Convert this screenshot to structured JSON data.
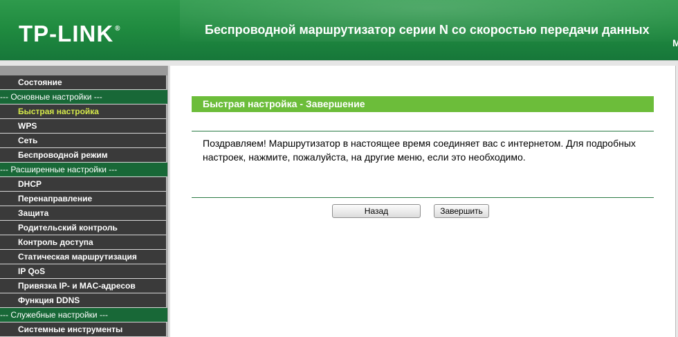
{
  "header": {
    "logo": "TP-LINK",
    "logo_mark": "®",
    "title": "Беспроводной маршрутизатор серии N со скоростью передачи данных",
    "subtitle": "М"
  },
  "sidebar": {
    "items": [
      {
        "label": "Состояние",
        "type": "item"
      },
      {
        "label": "--- Основные настройки ---",
        "type": "group"
      },
      {
        "label": "Быстрая настройка",
        "type": "item",
        "active": true
      },
      {
        "label": "WPS",
        "type": "item"
      },
      {
        "label": "Сеть",
        "type": "item"
      },
      {
        "label": "Беспроводной режим",
        "type": "item"
      },
      {
        "label": "--- Расширенные настройки ---",
        "type": "group"
      },
      {
        "label": "DHCP",
        "type": "item"
      },
      {
        "label": "Перенаправление",
        "type": "item"
      },
      {
        "label": "Защита",
        "type": "item"
      },
      {
        "label": "Родительский контроль",
        "type": "item"
      },
      {
        "label": "Контроль доступа",
        "type": "item"
      },
      {
        "label": "Статическая маршрутизация",
        "type": "item"
      },
      {
        "label": "IP QoS",
        "type": "item"
      },
      {
        "label": "Привязка IP- и MAC-адресов",
        "type": "item"
      },
      {
        "label": "Функция DDNS",
        "type": "item"
      },
      {
        "label": "--- Служебные настройки ---",
        "type": "group"
      },
      {
        "label": "Системные инструменты",
        "type": "item"
      }
    ]
  },
  "main": {
    "section_title": "Быстрая настройка - Завершение",
    "message": "Поздравляем! Маршрутизатор в настоящее время соединяет вас с интернетом. Для подробных настроек, нажмите, пожалуйста, на другие меню, если это необходимо.",
    "back_label": "Назад",
    "finish_label": "Завершить"
  },
  "colors": {
    "header_green": "#1f8a3f",
    "section_green": "#6cbd3a",
    "menu_dark": "#3a3a3a",
    "menu_group": "#186837",
    "active_text": "#d4e84a"
  }
}
